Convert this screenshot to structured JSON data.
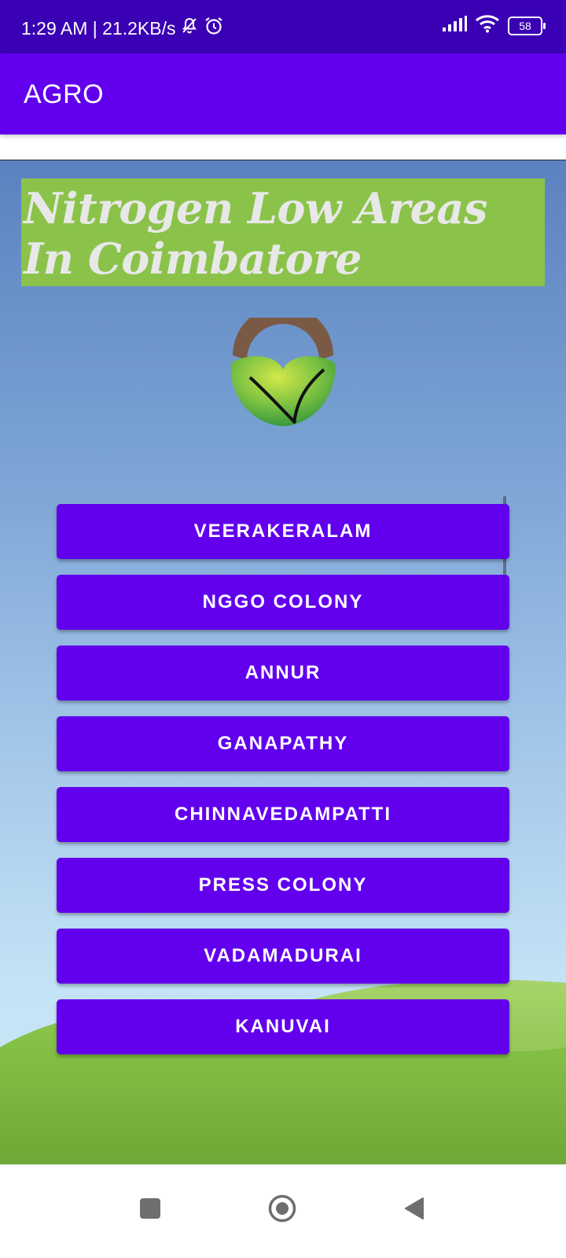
{
  "status_bar": {
    "time_speed": "1:29 AM | 21.2KB/s",
    "battery": "58",
    "icons": [
      "mute-bell-icon",
      "alarm-icon",
      "signal-icon",
      "wifi-icon",
      "battery-icon"
    ]
  },
  "app_bar": {
    "title": "AGRO"
  },
  "page": {
    "heading": "Nitrogen Low Areas In Coimbatore",
    "logo": "leaf-logo-icon"
  },
  "areas": [
    {
      "label": "VEERAKERALAM"
    },
    {
      "label": "NGGO COLONY"
    },
    {
      "label": "ANNUR"
    },
    {
      "label": "GANAPATHY"
    },
    {
      "label": "CHINNAVEDAMPATTI"
    },
    {
      "label": "PRESS COLONY"
    },
    {
      "label": "VADAMADURAI"
    },
    {
      "label": "KANUVAI"
    }
  ],
  "nav_bar": {
    "icons": [
      "recents-square-icon",
      "home-circle-icon",
      "back-triangle-icon"
    ]
  },
  "colors": {
    "status_bar": "#3a00b3",
    "primary": "#6200ee",
    "heading_bg": "#8bc34a",
    "heading_text": "#e8e8e8"
  }
}
